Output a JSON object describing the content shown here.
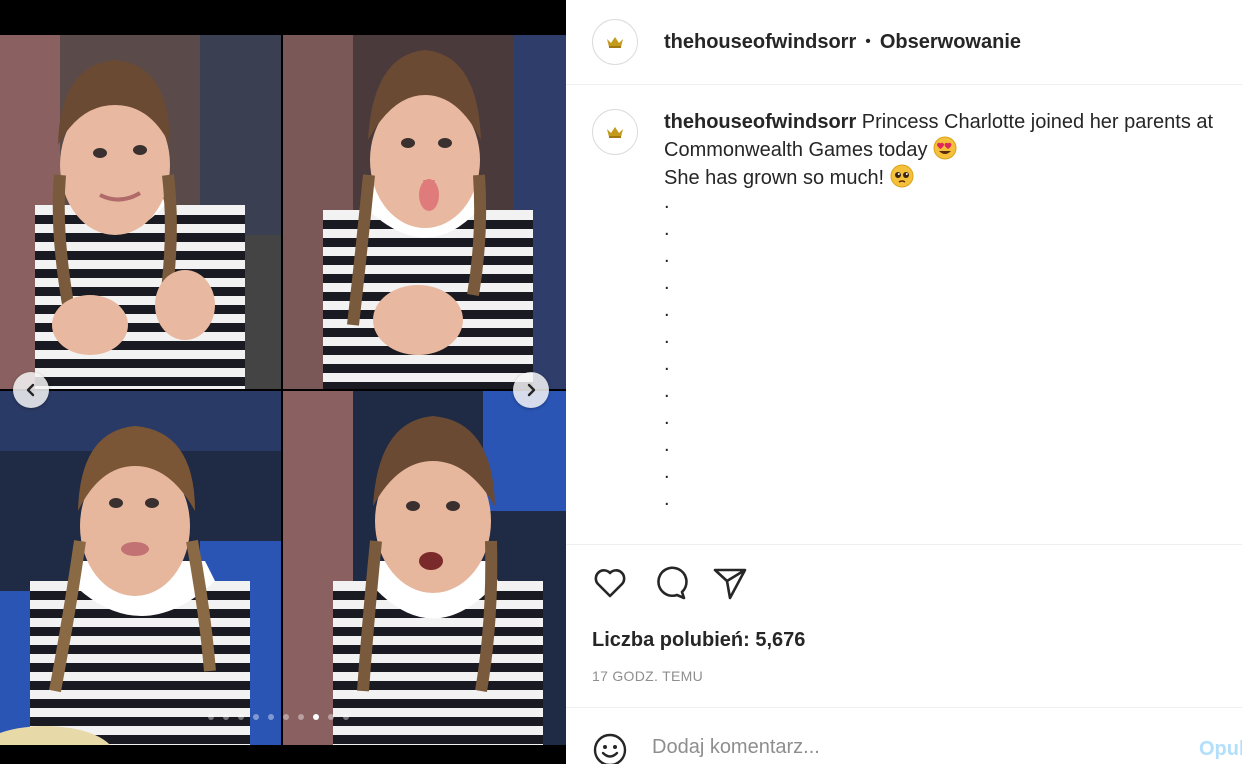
{
  "post": {
    "username": "thehouseofwindsorr",
    "separator": "•",
    "follow_label": "Obserwowanie",
    "caption_line1": "Princess Charlotte joined her parents at Commonwealth Games today",
    "caption_line2": "She has grown so much!",
    "caption_dots": [
      ".",
      ".",
      ".",
      ".",
      ".",
      ".",
      ".",
      ".",
      ".",
      ".",
      ".",
      "."
    ],
    "likes_label": "Liczba polubień: 5,676",
    "timestamp": "17 GODZ. TEMU",
    "comment_placeholder": "Dodaj komentarz...",
    "post_button": "Opublikuj"
  },
  "media": {
    "image_count": 10,
    "active_index": 7
  },
  "icons": {
    "avatar": "crown-icon",
    "like": "heart-icon",
    "comment": "comment-bubble-icon",
    "share": "send-icon",
    "emoji": "smiley-icon",
    "prev": "chevron-left-icon",
    "next": "chevron-right-icon"
  },
  "colors": {
    "crown": "#c49a1a",
    "post_button": "#b2dffc",
    "muted_text": "#8e8e8e"
  }
}
